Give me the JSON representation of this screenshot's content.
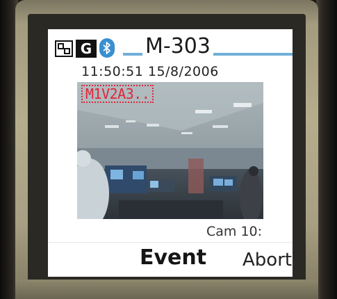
{
  "status_bar": {
    "title": "M-303",
    "network_icon": "network-indicator-icon",
    "gprs_label": "G",
    "bluetooth_icon": "bluetooth-icon",
    "line_color": "#6fb0d8"
  },
  "viewer": {
    "timestamp": "11:50:51  15/8/2006",
    "overlay": "M1V2A3..",
    "overlay_color": "#e0253a",
    "camera_label": "Cam 10:"
  },
  "softkeys": {
    "center_label": "Event",
    "right_label": "Abort"
  }
}
